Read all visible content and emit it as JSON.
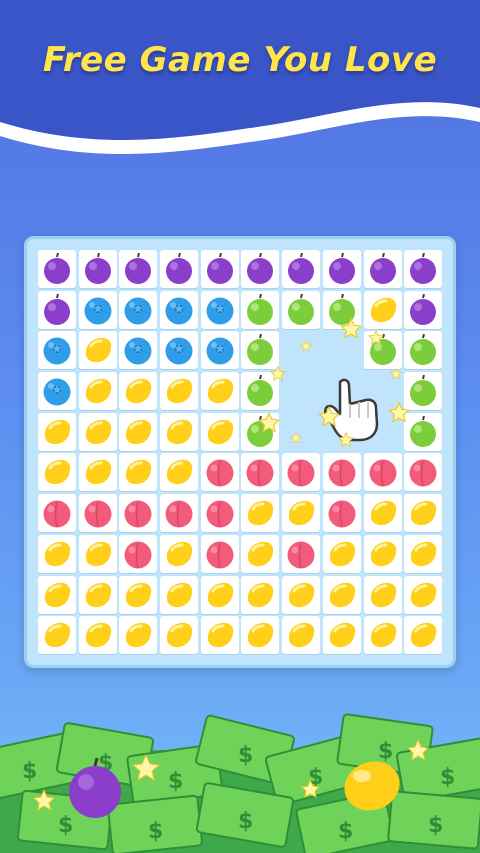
{
  "title": "Free Game You Love",
  "colors": {
    "title": "#ffe44a",
    "grape": "#8a3ec9",
    "blueberry": "#2f9de8",
    "lime": "#7ccd3c",
    "lemon": "#ffcf1a",
    "peach": "#f25c7a"
  },
  "grid": [
    [
      "grape",
      "grape",
      "grape",
      "grape",
      "grape",
      "grape",
      "grape",
      "grape",
      "grape",
      "grape"
    ],
    [
      "grape",
      "blueberry",
      "blueberry",
      "blueberry",
      "blueberry",
      "lime",
      "lime",
      "lime",
      "lemon",
      "grape"
    ],
    [
      "blueberry",
      "lemon",
      "blueberry",
      "blueberry",
      "blueberry",
      "lime",
      "empty",
      "empty",
      "lime",
      "lime"
    ],
    [
      "blueberry",
      "lemon",
      "lemon",
      "lemon",
      "lemon",
      "lime",
      "empty",
      "empty",
      "empty",
      "lime"
    ],
    [
      "lemon",
      "lemon",
      "lemon",
      "lemon",
      "lemon",
      "lime",
      "empty",
      "empty",
      "empty",
      "lime"
    ],
    [
      "lemon",
      "lemon",
      "lemon",
      "lemon",
      "peach",
      "peach",
      "peach",
      "peach",
      "peach",
      "peach"
    ],
    [
      "peach",
      "peach",
      "peach",
      "peach",
      "peach",
      "lemon",
      "lemon",
      "peach",
      "lemon",
      "lemon"
    ],
    [
      "lemon",
      "lemon",
      "peach",
      "lemon",
      "peach",
      "lemon",
      "peach",
      "lemon",
      "lemon",
      "lemon"
    ],
    [
      "lemon",
      "lemon",
      "lemon",
      "lemon",
      "lemon",
      "lemon",
      "lemon",
      "lemon",
      "lemon",
      "lemon"
    ],
    [
      "lemon",
      "lemon",
      "lemon",
      "lemon",
      "lemon",
      "lemon",
      "lemon",
      "lemon",
      "lemon",
      "lemon"
    ]
  ],
  "icons": {
    "grape": "grape-fruit-icon",
    "blueberry": "blueberry-fruit-icon",
    "lime": "lime-fruit-icon",
    "lemon": "lemon-fruit-icon",
    "peach": "peach-fruit-icon",
    "hand": "tap-hand-icon",
    "sparkle": "sparkle-star-icon",
    "money": "money-pile-icon"
  }
}
